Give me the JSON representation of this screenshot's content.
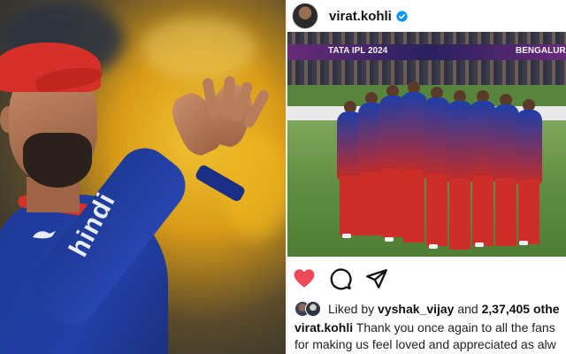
{
  "post": {
    "username": "virat.kohli",
    "verified": true,
    "image_banner_left": "TATA IPL 2024",
    "image_banner_right": "BENGALURU",
    "actions": [
      "heart-icon",
      "comment-icon",
      "share-icon"
    ],
    "liked_prefix": "Liked by",
    "liked_user": "vyshak_vijay",
    "liked_and": "and",
    "liked_count": "2,37,405",
    "liked_suffix": "othe",
    "caption_user": "virat.kohli",
    "caption_line1": "Thank you once again to all the fans",
    "caption_line2": "for making us feel loved and appreciated as alw"
  },
  "left_photo": {
    "jersey_brand": "PUMA",
    "jersey_sponsor": "hindi"
  },
  "colors": {
    "heart": "#ed4956",
    "verified": "#0095f6",
    "jersey_blue": "#1c3a96",
    "jersey_red": "#d5302a"
  }
}
